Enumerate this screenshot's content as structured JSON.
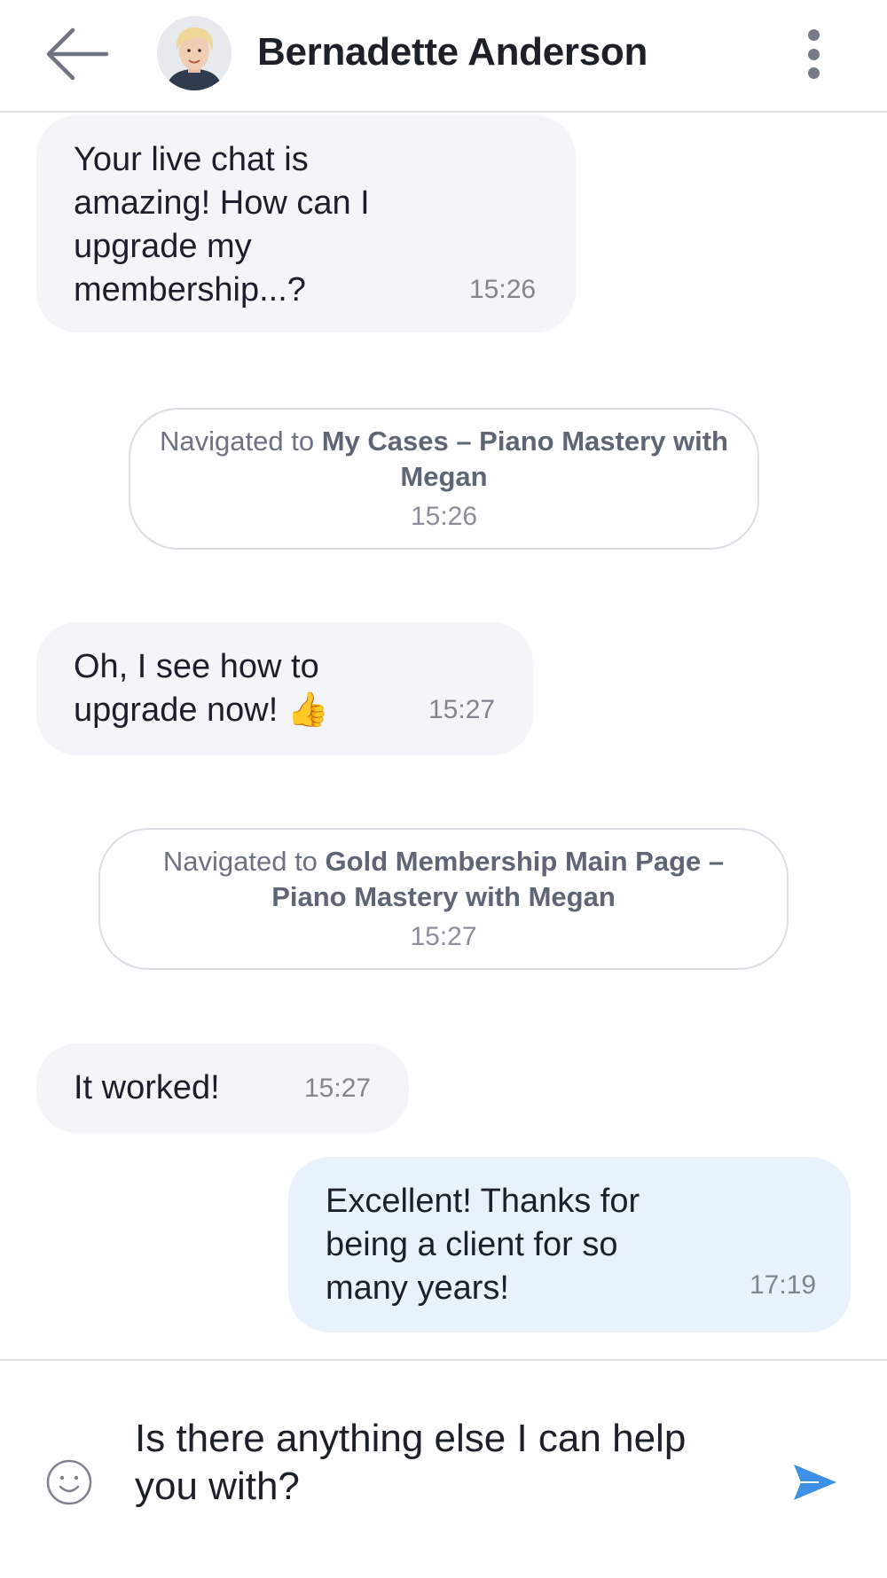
{
  "header": {
    "contact_name": "Bernadette Anderson",
    "icons": {
      "back": "arrow-left-icon",
      "menu": "more-vertical-icon"
    }
  },
  "messages": [
    {
      "type": "incoming",
      "text": "Your live chat is amazing! How can I upgrade my membership...?",
      "time": "15:26"
    },
    {
      "type": "event",
      "prefix": "Navigated to ",
      "page": "My Cases – Piano Mastery with Megan",
      "time": "15:26"
    },
    {
      "type": "incoming",
      "text": "Oh, I see how to upgrade now! 👍",
      "time": "15:27"
    },
    {
      "type": "event",
      "prefix": "Navigated to ",
      "page": "Gold Membership Main Page – Piano Mastery with Megan",
      "time": "15:27"
    },
    {
      "type": "incoming",
      "text": "It worked!",
      "time": "15:27"
    },
    {
      "type": "outgoing",
      "text": "Excellent! Thanks for being a client for so many years!",
      "time": "17:19"
    }
  ],
  "composer": {
    "value": "Is there anything else I can help you with?",
    "icons": {
      "emoji": "smiley-icon",
      "send": "send-icon"
    },
    "accent_color": "#3d8fe8"
  }
}
